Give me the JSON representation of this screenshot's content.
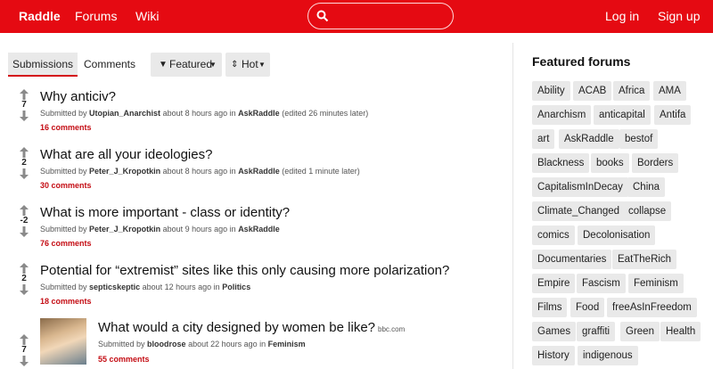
{
  "header": {
    "brand": "Raddle",
    "nav": [
      "Forums",
      "Wiki"
    ],
    "search_placeholder": "",
    "login": "Log in",
    "signup": "Sign up"
  },
  "toolbar": {
    "tabs": [
      "Submissions",
      "Comments"
    ],
    "featured": "Featured",
    "hot": "Hot"
  },
  "posts": [
    {
      "score": "7",
      "title": "Why anticiv?",
      "submitted_by": "Submitted by",
      "user": "Utopian_Anarchist",
      "time": "about 8 hours ago in",
      "forum": "AskRaddle",
      "edited": "(edited 26 minutes later)",
      "comments": "16 comments"
    },
    {
      "score": "2",
      "title": "What are all your ideologies?",
      "submitted_by": "Submitted by",
      "user": "Peter_J_Kropotkin",
      "time": "about 8 hours ago in",
      "forum": "AskRaddle",
      "edited": "(edited 1 minute later)",
      "comments": "30 comments"
    },
    {
      "score": "-2",
      "title": "What is more important - class or identity?",
      "submitted_by": "Submitted by",
      "user": "Peter_J_Kropotkin",
      "time": "about 9 hours ago in",
      "forum": "AskRaddle",
      "edited": "",
      "comments": "76 comments"
    },
    {
      "score": "2",
      "title": "Potential for “extremist” sites like this only causing more polarization?",
      "submitted_by": "Submitted by",
      "user": "septicskeptic",
      "time": "about 12 hours ago in",
      "forum": "Politics",
      "edited": "",
      "comments": "18 comments"
    },
    {
      "score": "7",
      "title": "What would a city designed by women be like?",
      "domain": "bbc.com",
      "submitted_by": "Submitted by",
      "user": "bloodrose",
      "time": "about 22 hours ago in",
      "forum": "Feminism",
      "edited": "",
      "comments": "55 comments"
    }
  ],
  "sidebar": {
    "title": "Featured forums",
    "forums": [
      "Ability",
      "ACAB",
      "Africa",
      "AMA",
      "Anarchism",
      "anticapital",
      "Antifa",
      "art",
      "AskRaddle",
      "bestof",
      "Blackness",
      "books",
      "Borders",
      "CapitalismInDecay",
      "China",
      "Climate_Changed",
      "collapse",
      "comics",
      "Decolonisation",
      "Documentaries",
      "EatTheRich",
      "Empire",
      "Fascism",
      "Feminism",
      "Films",
      "Food",
      "freeAsInFreedom",
      "Games",
      "graffiti",
      "Green",
      "Health",
      "History",
      "indigenous"
    ]
  }
}
